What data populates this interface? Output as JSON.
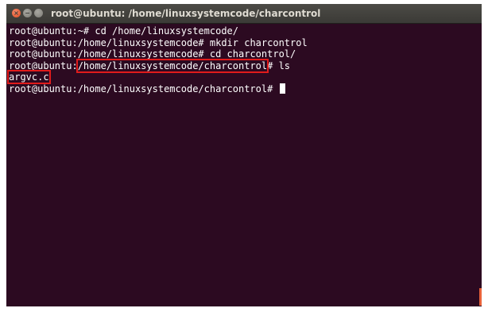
{
  "window": {
    "title": "root@ubuntu: /home/linuxsystemcode/charcontrol"
  },
  "terminal": {
    "lines": [
      {
        "prompt": "root@ubuntu:~# ",
        "command": "cd /home/linuxsystemcode/"
      },
      {
        "prompt": "root@ubuntu:/home/linuxsystemcode# ",
        "command": "mkdir charcontrol"
      },
      {
        "prompt": "root@ubuntu:/home/linuxsystemcode# ",
        "command": "cd charcontrol/"
      },
      {
        "prompt_user": "root@ubuntu:",
        "prompt_path": "/home/linuxsystemcode/charcontrol",
        "prompt_end": "# ",
        "command": "ls"
      },
      {
        "output": "argvc.c"
      },
      {
        "prompt": "root@ubuntu:/home/linuxsystemcode/charcontrol# "
      }
    ]
  },
  "colors": {
    "terminal_background": "#2c0a21",
    "terminal_text": "#ffffff",
    "highlight_box": "#e01b1b",
    "titlebar": "#3b3a36"
  },
  "icons": [
    "close-icon",
    "minimize-icon",
    "maximize-icon"
  ]
}
